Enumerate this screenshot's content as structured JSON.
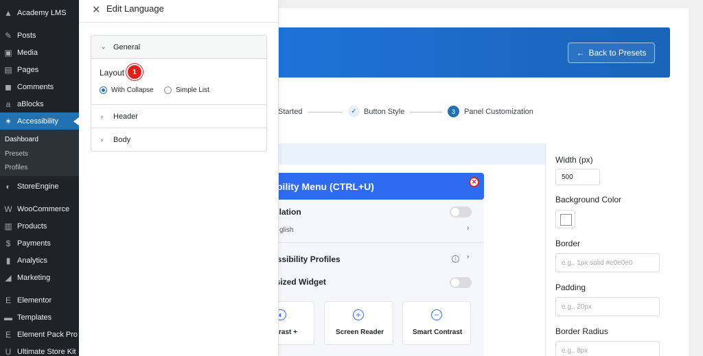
{
  "sidebar": {
    "items": [
      {
        "label": "Academy LMS",
        "icon": "mortarboard-icon",
        "glyph": "▲"
      },
      {
        "label": "Posts",
        "icon": "pin-icon",
        "glyph": "✎"
      },
      {
        "label": "Media",
        "icon": "media-icon",
        "glyph": "▣"
      },
      {
        "label": "Pages",
        "icon": "pages-icon",
        "glyph": "▤"
      },
      {
        "label": "Comments",
        "icon": "comment-icon",
        "glyph": "◼"
      },
      {
        "label": "aBlocks",
        "icon": "ablocks-icon",
        "glyph": "a"
      },
      {
        "label": "Accessibility",
        "icon": "accessibility-icon",
        "glyph": "✶"
      },
      {
        "label": "StoreEngine",
        "icon": "storeengine-icon",
        "glyph": "◐"
      },
      {
        "label": "WooCommerce",
        "icon": "woocommerce-icon",
        "glyph": "W"
      },
      {
        "label": "Products",
        "icon": "products-icon",
        "glyph": "▥"
      },
      {
        "label": "Payments",
        "icon": "payments-icon",
        "glyph": "$"
      },
      {
        "label": "Analytics",
        "icon": "analytics-icon",
        "glyph": "▮"
      },
      {
        "label": "Marketing",
        "icon": "megaphone-icon",
        "glyph": "◢"
      },
      {
        "label": "Elementor",
        "icon": "elementor-icon",
        "glyph": "E"
      },
      {
        "label": "Templates",
        "icon": "folder-icon",
        "glyph": "▬"
      },
      {
        "label": "Element Pack Pro",
        "icon": "elementpack-icon",
        "glyph": "E"
      },
      {
        "label": "Ultimate Store Kit",
        "icon": "storekit-icon",
        "glyph": "U"
      }
    ],
    "submenu": [
      "Dashboard",
      "Presets",
      "Profiles"
    ]
  },
  "drawer": {
    "title": "Edit Language",
    "close_icon": "close-icon",
    "sections": {
      "general": "General",
      "header": "Header",
      "body": "Body"
    },
    "layout_label": "Layout",
    "badge": "1",
    "options": {
      "with_collapse": "With Collapse",
      "simple_list": "Simple List"
    },
    "selected": "With Collapse"
  },
  "hero": {
    "back_label": "Back to Presets",
    "back_arrow": "←"
  },
  "steps": {
    "step1": "Started",
    "step2": "Button Style",
    "step3_num": "3",
    "step3": "Panel Customization",
    "check": "✓"
  },
  "preview": {
    "header": "bility Menu (CTRL+U)",
    "close": "✕",
    "rows": {
      "translation": "slation",
      "language": "glish",
      "profiles": "essibility Profiles",
      "oversized": "rsized Widget"
    },
    "tiles": [
      {
        "label": "rast +",
        "icon": "contrast-icon",
        "glyph": "◐"
      },
      {
        "label": "Screen Reader",
        "icon": "plus-circle-icon",
        "glyph": "+"
      },
      {
        "label": "Smart Contrast",
        "icon": "minus-circle-icon",
        "glyph": "−"
      }
    ],
    "info": "i",
    "chevron": "›"
  },
  "settings": {
    "width_label": "Width (px)",
    "width_value": "500",
    "bg_label": "Background Color",
    "border_label": "Border",
    "border_placeholder": "e.g., 1px solid #e0e0e0",
    "padding_label": "Padding",
    "padding_placeholder": "e.g., 20px",
    "radius_label": "Border Radius",
    "radius_placeholder": "e.g., 8px"
  },
  "colors": {
    "wp_sidebar": "#1d2327",
    "accent": "#2271b1",
    "hero": "#1e73d9",
    "badge": "#e0201c"
  }
}
